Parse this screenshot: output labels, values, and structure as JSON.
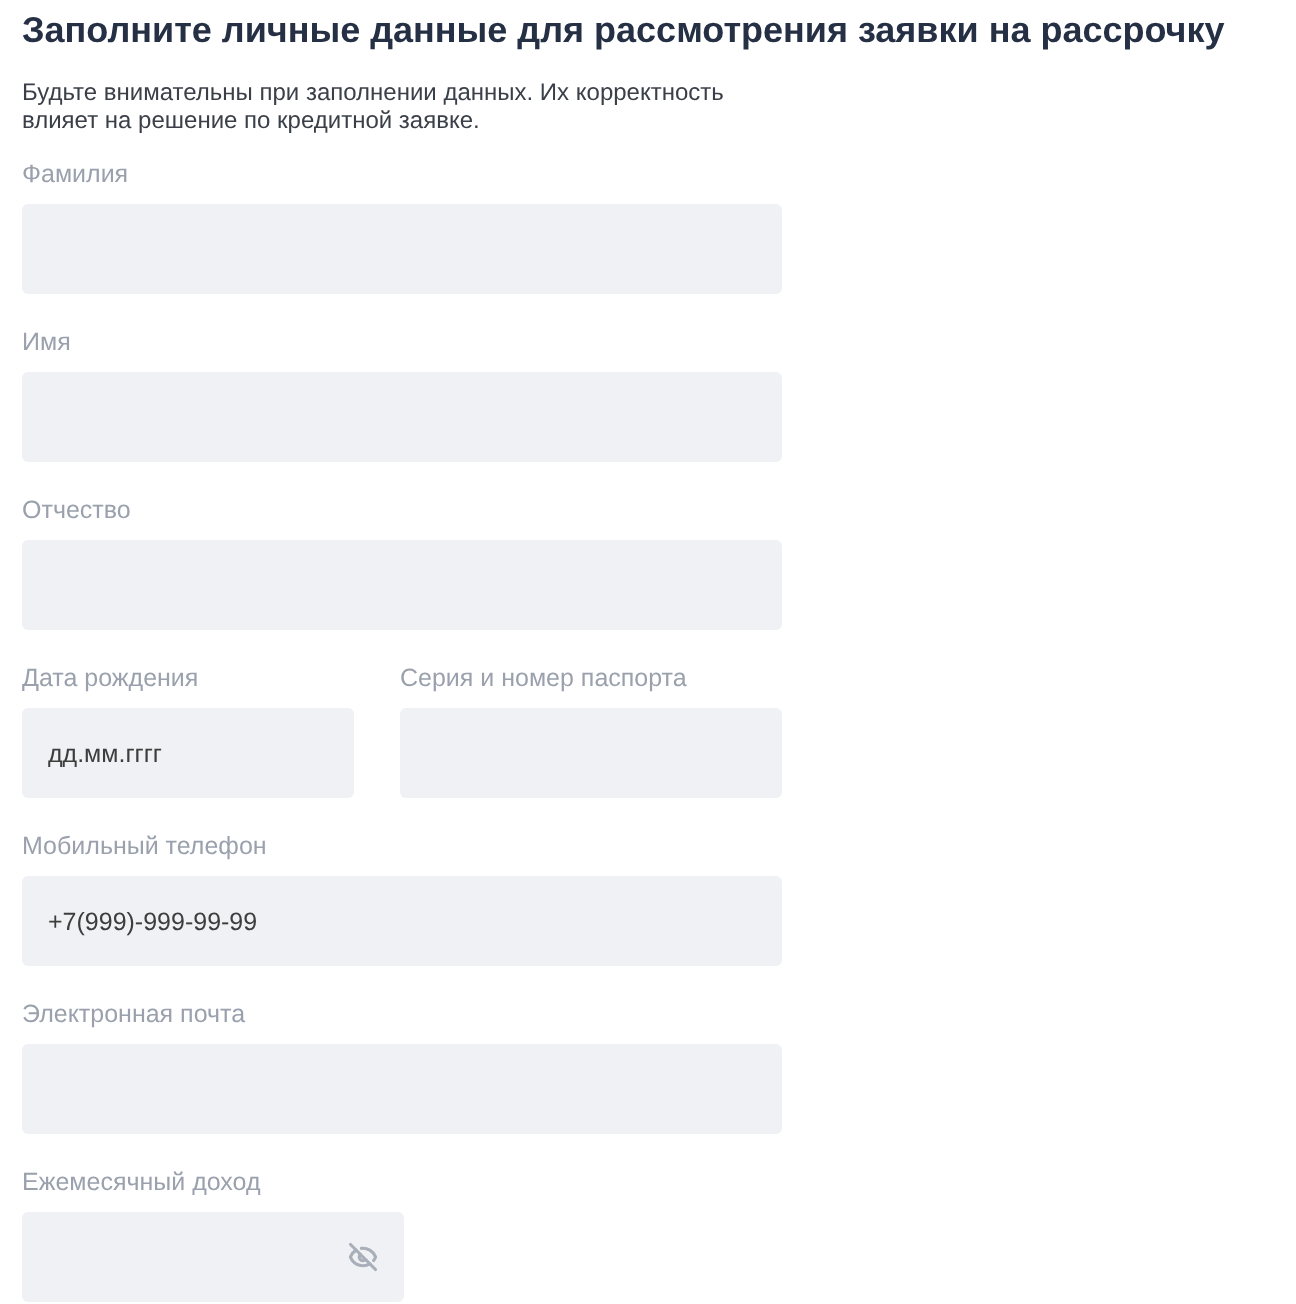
{
  "title": "Заполните личные данные для рассмотрения заявки на рассрочку",
  "intro": [
    "Будьте внимательны при заполнении данных. Их корректность",
    "влияет на решение по кредитной заявке."
  ],
  "rows": [
    {
      "fields": [
        {
          "label": "Фамилия"
        }
      ]
    },
    {
      "fields": [
        {
          "label": "Имя"
        }
      ]
    },
    {
      "fields": [
        {
          "label": "Отчество"
        }
      ]
    },
    {
      "fields": [
        {
          "label": "Дата рождения",
          "placeholder": "дд.мм.гггг"
        },
        {
          "label": "Серия и номер паспорта"
        }
      ]
    },
    {
      "fields": [
        {
          "label": "Мобильный телефон",
          "placeholder": "+7(999)-999-99-99"
        }
      ]
    },
    {
      "fields": [
        {
          "label": "Электронная почта"
        }
      ]
    },
    {
      "fields": [
        {
          "label": "Ежемесячный доход",
          "hidden_value": true
        }
      ]
    }
  ]
}
